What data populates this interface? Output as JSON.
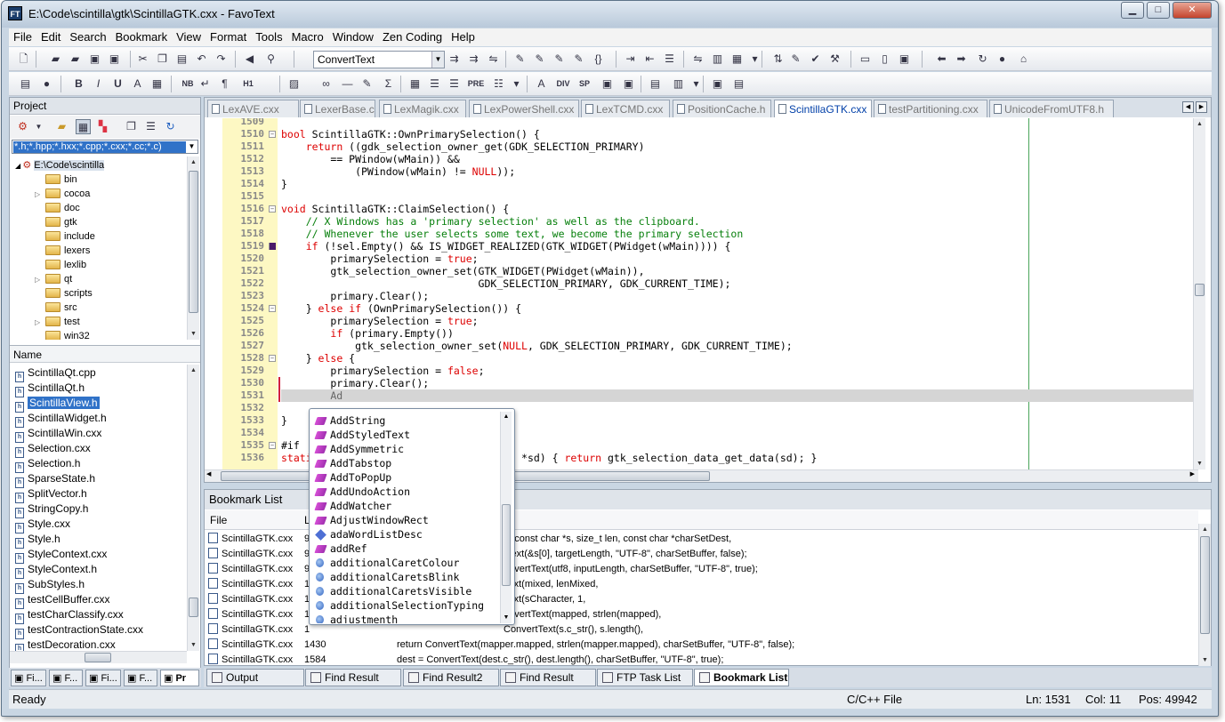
{
  "window": {
    "title": "E:\\Code\\scintilla\\gtk\\ScintillaGTK.cxx - FavoText",
    "app_icon": "FT"
  },
  "menu": [
    "File",
    "Edit",
    "Search",
    "Bookmark",
    "View",
    "Format",
    "Tools",
    "Macro",
    "Window",
    "Zen Coding",
    "Help"
  ],
  "toolbar": {
    "combo_value": "ConvertText"
  },
  "toolbar2_labels": {
    "nb": "NB",
    "h1": "H1",
    "pre": "PRE",
    "div": "DIV",
    "sp": "SP"
  },
  "project": {
    "title": "Project",
    "filter": "*.h;*.hpp;*.hxx;*.cpp;*.cxx;*.cc;*.c)",
    "root": "E:\\Code\\scintilla",
    "folders": [
      "bin",
      "cocoa",
      "doc",
      "gtk",
      "include",
      "lexers",
      "lexlib",
      "qt",
      "scripts",
      "src",
      "test",
      "win32"
    ],
    "names_header": "Name",
    "files": [
      "ScintillaQt.cpp",
      "ScintillaQt.h",
      "ScintillaView.h",
      "ScintillaWidget.h",
      "ScintillaWin.cxx",
      "Selection.cxx",
      "Selection.h",
      "SparseState.h",
      "SplitVector.h",
      "StringCopy.h",
      "Style.cxx",
      "Style.h",
      "StyleContext.cxx",
      "StyleContext.h",
      "SubStyles.h",
      "testCellBuffer.cxx",
      "testCharClassify.cxx",
      "testContractionState.cxx",
      "testDecoration.cxx"
    ],
    "selected_file": "ScintillaView.h",
    "bottom_tabs": [
      "Fi...",
      "F...",
      "Fi...",
      "F...",
      "Pr"
    ]
  },
  "editor": {
    "tabs": [
      "LexAVE.cxx",
      "LexerBase.cxx",
      "LexMagik.cxx",
      "LexPowerShell.cxx",
      "LexTCMD.cxx",
      "PositionCache.h",
      "ScintillaGTK.cxx",
      "testPartitioning.cxx",
      "UnicodeFromUTF8.h"
    ],
    "active_tab": "ScintillaGTK.cxx",
    "current_line": "1531",
    "lines": [
      {
        "n": "1509",
        "t": ""
      },
      {
        "n": "1510",
        "t": "bool ScintillaGTK::OwnPrimarySelection() {"
      },
      {
        "n": "1511",
        "t": "    return ((gdk_selection_owner_get(GDK_SELECTION_PRIMARY)"
      },
      {
        "n": "1512",
        "t": "        == PWindow(wMain)) &&"
      },
      {
        "n": "1513",
        "t": "            (PWindow(wMain) != NULL));"
      },
      {
        "n": "1514",
        "t": "}"
      },
      {
        "n": "1515",
        "t": ""
      },
      {
        "n": "1516",
        "t": "void ScintillaGTK::ClaimSelection() {"
      },
      {
        "n": "1517",
        "t": "    // X Windows has a 'primary selection' as well as the clipboard."
      },
      {
        "n": "1518",
        "t": "    // Whenever the user selects some text, we become the primary selection"
      },
      {
        "n": "1519",
        "t": "    if (!sel.Empty() && IS_WIDGET_REALIZED(GTK_WIDGET(PWidget(wMain)))) {"
      },
      {
        "n": "1520",
        "t": "        primarySelection = true;"
      },
      {
        "n": "1521",
        "t": "        gtk_selection_owner_set(GTK_WIDGET(PWidget(wMain)),"
      },
      {
        "n": "1522",
        "t": "                                GDK_SELECTION_PRIMARY, GDK_CURRENT_TIME);"
      },
      {
        "n": "1523",
        "t": "        primary.Clear();"
      },
      {
        "n": "1524",
        "t": "    } else if (OwnPrimarySelection()) {"
      },
      {
        "n": "1525",
        "t": "        primarySelection = true;"
      },
      {
        "n": "1526",
        "t": "        if (primary.Empty())"
      },
      {
        "n": "1527",
        "t": "            gtk_selection_owner_set(NULL, GDK_SELECTION_PRIMARY, GDK_CURRENT_TIME);"
      },
      {
        "n": "1528",
        "t": "    } else {"
      },
      {
        "n": "1529",
        "t": "        primarySelection = false;"
      },
      {
        "n": "1530",
        "t": "        primary.Clear();"
      },
      {
        "n": "1531",
        "t": "        Ad"
      },
      {
        "n": "1532",
        "t": ""
      },
      {
        "n": "1533",
        "t": "}"
      },
      {
        "n": "1534",
        "t": ""
      },
      {
        "n": "1535",
        "t": "#if"
      },
      {
        "n": "1536",
        "t": "static                       ctionData *sd) { return gtk_selection_data_get_data(sd); }"
      }
    ]
  },
  "autocomplete": {
    "items": [
      {
        "label": "AddString",
        "kind": "method"
      },
      {
        "label": "AddStyledText",
        "kind": "method"
      },
      {
        "label": "AddSymmetric",
        "kind": "method"
      },
      {
        "label": "AddTabstop",
        "kind": "method"
      },
      {
        "label": "AddToPopUp",
        "kind": "method"
      },
      {
        "label": "AddUndoAction",
        "kind": "method"
      },
      {
        "label": "AddWatcher",
        "kind": "method"
      },
      {
        "label": "AdjustWindowRect",
        "kind": "method"
      },
      {
        "label": "adaWordListDesc",
        "kind": "variable"
      },
      {
        "label": "addRef",
        "kind": "method"
      },
      {
        "label": "additionalCaretColour",
        "kind": "property"
      },
      {
        "label": "additionalCaretsBlink",
        "kind": "property"
      },
      {
        "label": "additionalCaretsVisible",
        "kind": "property"
      },
      {
        "label": "additionalSelectionTyping",
        "kind": "property"
      },
      {
        "label": "adjustmenth",
        "kind": "property"
      }
    ]
  },
  "bookmarks": {
    "title": "Bookmark List",
    "columns": {
      "file": "File",
      "line": "Li"
    },
    "rows": [
      {
        "file": "ScintillaGTK.cxx",
        "line": "9",
        "text": "xt(const char *s, size_t len, const char *charSetDest,"
      },
      {
        "file": "ScintillaGTK.cxx",
        "line": "9",
        "text": "tText(&s[0], targetLength, \"UTF-8\", charSetBuffer, false);"
      },
      {
        "file": "ScintillaGTK.cxx",
        "line": "9",
        "text": "onvertText(utf8, inputLength, charSetBuffer, \"UTF-8\", true);"
      },
      {
        "file": "ScintillaGTK.cxx",
        "line": "1",
        "text": "Text(mixed, lenMixed,"
      },
      {
        "file": "ScintillaGTK.cxx",
        "line": "1",
        "text": "Text(sCharacter, 1,"
      },
      {
        "file": "ScintillaGTK.cxx",
        "line": "1",
        "text": "onvertText(mapped, strlen(mapped),"
      },
      {
        "file": "ScintillaGTK.cxx",
        "line": "1",
        "text": "ConvertText(s.c_str(), s.length(),"
      },
      {
        "file": "ScintillaGTK.cxx",
        "line": "1430",
        "text": "return ConvertText(mapper.mapped, strlen(mapper.mapped), charSetBuffer, \"UTF-8\", false);"
      },
      {
        "file": "ScintillaGTK.cxx",
        "line": "1584",
        "text": "dest = ConvertText(dest.c_str(), dest.length(), charSetBuffer, \"UTF-8\", true);"
      }
    ]
  },
  "bottom_tabs": [
    "Output",
    "Find Result",
    "Find Result2",
    "Find Result",
    "FTP Task List",
    "Bookmark List"
  ],
  "active_bottom_tab": "Bookmark List",
  "status": {
    "left": "Ready",
    "lang": "C/C++ File",
    "ln": "Ln: 1531",
    "col": "Col: 11",
    "pos": "Pos: 49942"
  }
}
